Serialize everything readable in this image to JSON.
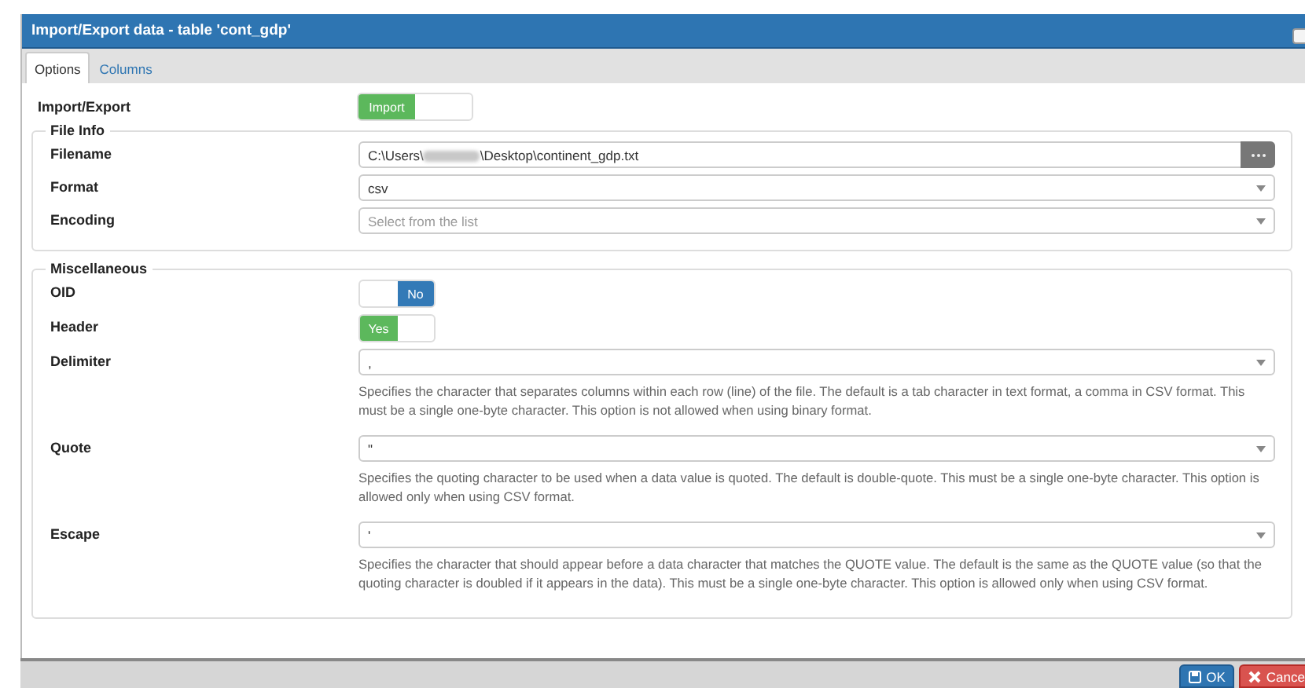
{
  "dialog": {
    "title": "Import/Export data - table 'cont_gdp'"
  },
  "tabs": [
    {
      "label": "Options",
      "selected": true
    },
    {
      "label": "Columns",
      "selected": false
    }
  ],
  "import_export": {
    "label": "Import/Export",
    "toggle": {
      "text": "Import",
      "on": true
    }
  },
  "file_info": {
    "legend": "File Info",
    "rows": [
      {
        "label": "Filename",
        "kind": "file",
        "value_start": "C:\\Users\\",
        "value_end": "\\Desktop\\continent_gdp.txt"
      },
      {
        "label": "Format",
        "kind": "select",
        "value": "csv"
      },
      {
        "label": "Encoding",
        "kind": "select",
        "placeholder": "Select from the list"
      }
    ]
  },
  "miscellaneous": {
    "legend": "Miscellaneous",
    "rows": [
      {
        "label": "OID",
        "kind": "toggle",
        "text": "No",
        "on": false
      },
      {
        "label": "Header",
        "kind": "toggle",
        "text": "Yes",
        "on": true
      },
      {
        "label": "Delimiter",
        "kind": "select",
        "value": ",",
        "help": "Specifies the character that separates columns within each row (line) of the file. The default is a tab character in text format, a comma in CSV format. This must be a single one-byte character. This option is not allowed when using binary format."
      },
      {
        "label": "Quote",
        "kind": "select",
        "value": "\"",
        "help": "Specifies the quoting character to be used when a data value is quoted. The default is double-quote. This must be a single one-byte character. This option is allowed only when using CSV format."
      },
      {
        "label": "Escape",
        "kind": "select",
        "value": "'",
        "help": "Specifies the character that should appear before a data character that matches the QUOTE value. The default is the same as the QUOTE value (so that the quoting character is doubled if it appears in the data). This must be a single one-byte character. This option is allowed only when using CSV format."
      }
    ]
  },
  "footer": {
    "buttons": [
      {
        "label": "OK",
        "kind": "save"
      },
      {
        "label": "Cance",
        "kind": "cancel"
      }
    ]
  }
}
